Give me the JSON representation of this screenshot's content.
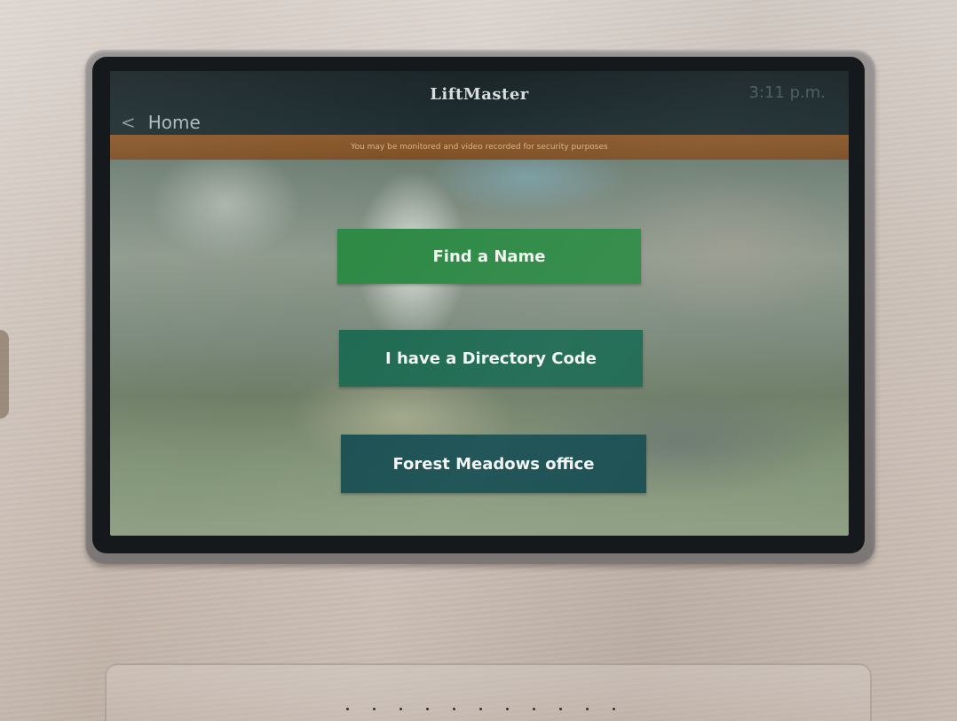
{
  "header": {
    "brand": "LiftMaster",
    "clock": "3:11 p.m.",
    "back_label": "Home"
  },
  "banner": {
    "text": "You may be monitored and video recorded for security purposes"
  },
  "menu": {
    "find_name": "Find a Name",
    "directory_code": "I have a Directory Code",
    "office": "Forest Meadows office"
  },
  "colors": {
    "find_button": "#2f8a46",
    "code_button": "#1f6a52",
    "office_button": "#1a4f52",
    "banner": "#8c5a2c"
  },
  "icons": {
    "back": "chevron-left-icon"
  }
}
